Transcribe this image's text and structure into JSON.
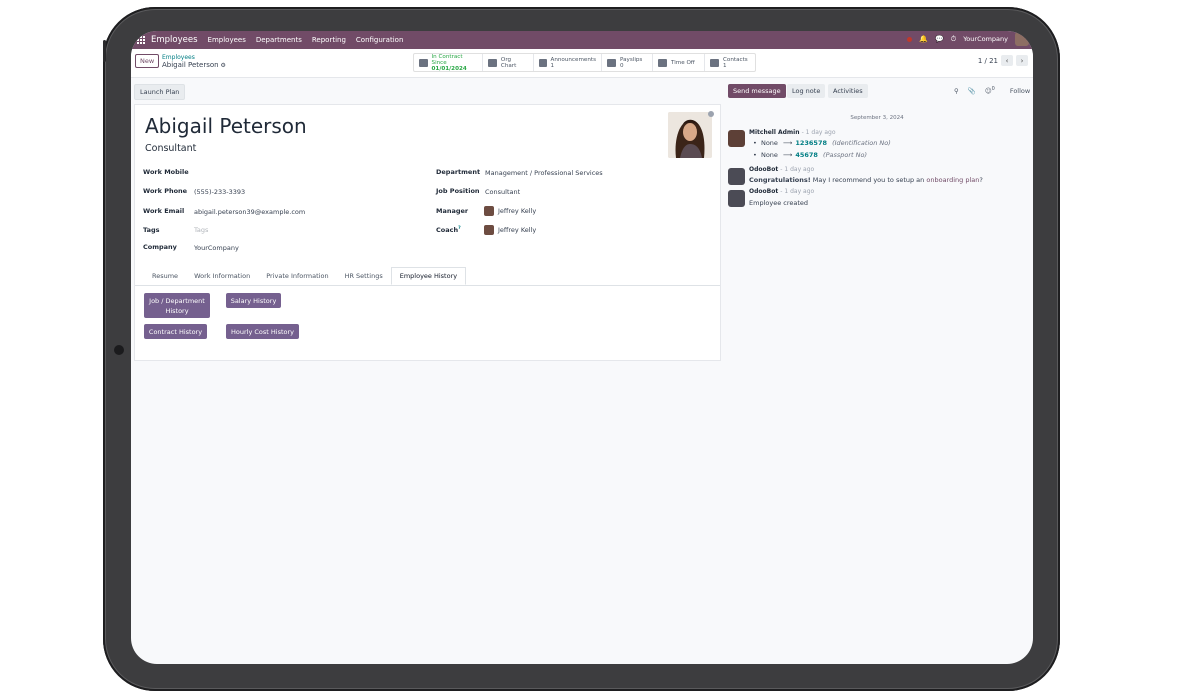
{
  "navbar": {
    "app_name": "Employees",
    "menu": [
      "Employees",
      "Departments",
      "Reporting",
      "Configuration"
    ],
    "company": "YourCompany"
  },
  "control_panel": {
    "new_label": "New",
    "breadcrumb_parent": "Employees",
    "breadcrumb_current": "Abigail Peterson",
    "pager": "1 / 21"
  },
  "smart_buttons": [
    {
      "line1": "In Contract Since",
      "line2": "01/01/2024",
      "icon": "contract-icon"
    },
    {
      "line1": "Org Chart",
      "line2": "",
      "icon": "org-chart-icon"
    },
    {
      "line1": "Announcements",
      "line2": "1",
      "icon": "megaphone-icon"
    },
    {
      "line1": "Payslips",
      "line2": "0",
      "icon": "payslip-icon"
    },
    {
      "line1": "Time Off",
      "line2": "",
      "icon": "calendar-icon"
    },
    {
      "line1": "Contacts",
      "line2": "1",
      "icon": "contact-card-icon"
    }
  ],
  "status_bar": {
    "launch_plan": "Launch Plan"
  },
  "employee": {
    "name": "Abigail Peterson",
    "job_title": "Consultant",
    "fields_left": [
      {
        "label": "Work Mobile",
        "value": ""
      },
      {
        "label": "Work Phone",
        "value": "(555)-233-3393"
      },
      {
        "label": "Work Email",
        "value": "abigail.peterson39@example.com"
      },
      {
        "label": "Tags",
        "value": "",
        "placeholder": "Tags"
      },
      {
        "label": "Company",
        "value": "YourCompany"
      }
    ],
    "fields_right": [
      {
        "label": "Department",
        "value": "Management / Professional Services"
      },
      {
        "label": "Job Position",
        "value": "Consultant"
      },
      {
        "label": "Manager",
        "value": "Jeffrey Kelly"
      },
      {
        "label": "Coach",
        "value": "Jeffrey Kelly",
        "superscript": "?"
      }
    ]
  },
  "tabs": [
    "Resume",
    "Work Information",
    "Private Information",
    "HR Settings",
    "Employee History"
  ],
  "active_tab": "Employee History",
  "history_buttons": {
    "job_department": "Job / Department History",
    "salary": "Salary History",
    "contract": "Contract History",
    "hourly_cost": "Hourly Cost History"
  },
  "chatter": {
    "send_message": "Send message",
    "log_note": "Log note",
    "activities": "Activities",
    "follower_count": "0",
    "follow": "Follow",
    "date_separator": "September 3, 2024",
    "messages": [
      {
        "author": "Mitchell Admin",
        "time": "- 1 day ago",
        "changes": [
          {
            "old": "None",
            "new": "1236578",
            "field": "(Identification No)"
          },
          {
            "old": "None",
            "new": "45678",
            "field": "(Passport No)"
          }
        ]
      },
      {
        "author": "OdooBot",
        "time": "- 1 day ago",
        "bold": "Congratulations!",
        "text": "May I recommend you to setup an",
        "link": "onboarding plan",
        "suffix": "?"
      },
      {
        "author": "OdooBot",
        "time": "- 1 day ago",
        "text": "Employee created"
      }
    ]
  },
  "colors": {
    "brand": "#714b67",
    "teal": "#017e84",
    "history_button": "#75608f"
  }
}
